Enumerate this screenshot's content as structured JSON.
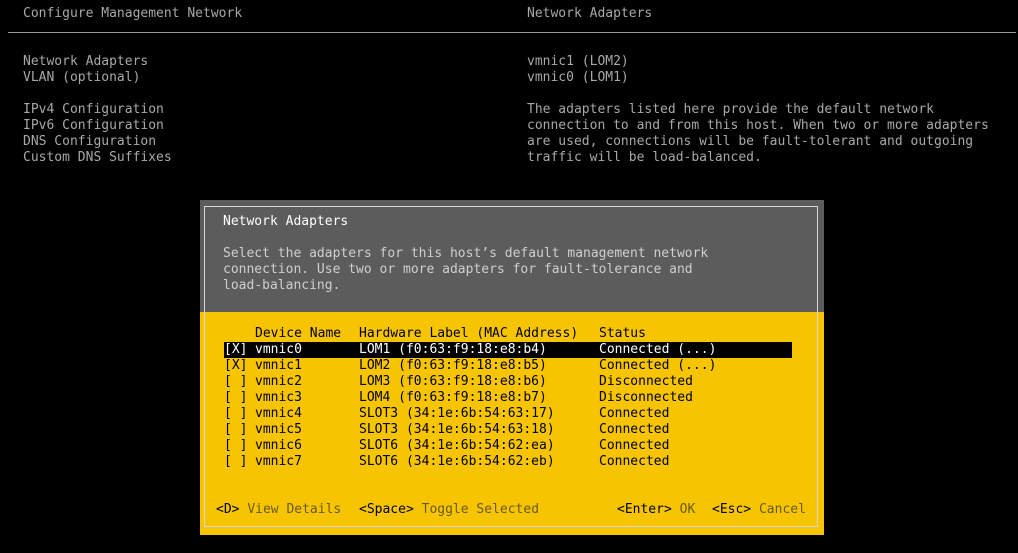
{
  "header": {
    "left_title": "Configure Management Network",
    "right_title": "Network Adapters"
  },
  "menu": {
    "items": [
      "Network Adapters",
      "VLAN (optional)",
      "IPv4 Configuration",
      "IPv6 Configuration",
      "DNS Configuration",
      "Custom DNS Suffixes"
    ]
  },
  "info": {
    "adapters": [
      "vmnic1 (LOM2)",
      "vmnic0 (LOM1)"
    ],
    "description": [
      "The adapters listed here provide the default network",
      "connection to and from this host. When two or more adapters",
      "are used, connections will be fault-tolerant and outgoing",
      "traffic will be load-balanced."
    ]
  },
  "dialog": {
    "title": "Network Adapters",
    "description": [
      "Select the adapters for this host’s default management network",
      "connection. Use two or more adapters for fault-tolerance and",
      "load-balancing."
    ],
    "columns": {
      "device": "Device Name",
      "hardware": "Hardware Label (MAC Address)",
      "status": "Status"
    },
    "rows": [
      {
        "check": "[X]",
        "device": "vmnic0",
        "hardware": "LOM1 (f0:63:f9:18:e8:b4)",
        "status": "Connected (...)"
      },
      {
        "check": "[X]",
        "device": "vmnic1",
        "hardware": "LOM2 (f0:63:f9:18:e8:b5)",
        "status": "Connected (...)"
      },
      {
        "check": "[ ]",
        "device": "vmnic2",
        "hardware": "LOM3 (f0:63:f9:18:e8:b6)",
        "status": "Disconnected"
      },
      {
        "check": "[ ]",
        "device": "vmnic3",
        "hardware": "LOM4 (f0:63:f9:18:e8:b7)",
        "status": "Disconnected"
      },
      {
        "check": "[ ]",
        "device": "vmnic4",
        "hardware": "SLOT3 (34:1e:6b:54:63:17)",
        "status": "Connected"
      },
      {
        "check": "[ ]",
        "device": "vmnic5",
        "hardware": "SLOT3 (34:1e:6b:54:63:18)",
        "status": "Connected"
      },
      {
        "check": "[ ]",
        "device": "vmnic6",
        "hardware": "SLOT6 (34:1e:6b:54:62:ea)",
        "status": "Connected"
      },
      {
        "check": "[ ]",
        "device": "vmnic7",
        "hardware": "SLOT6 (34:1e:6b:54:62:eb)",
        "status": "Connected"
      }
    ],
    "footer": {
      "view_key": "<D>",
      "view_label": "View Details",
      "toggle_key": "<Space>",
      "toggle_label": "Toggle Selected",
      "ok_key": "<Enter>",
      "ok_label": "OK",
      "cancel_key": "<Esc>",
      "cancel_label": "Cancel"
    }
  },
  "colors": {
    "background": "#000000",
    "dialog_body": "#f6c400",
    "dialog_header": "#5c5c5c",
    "selected_row": "#000000"
  }
}
